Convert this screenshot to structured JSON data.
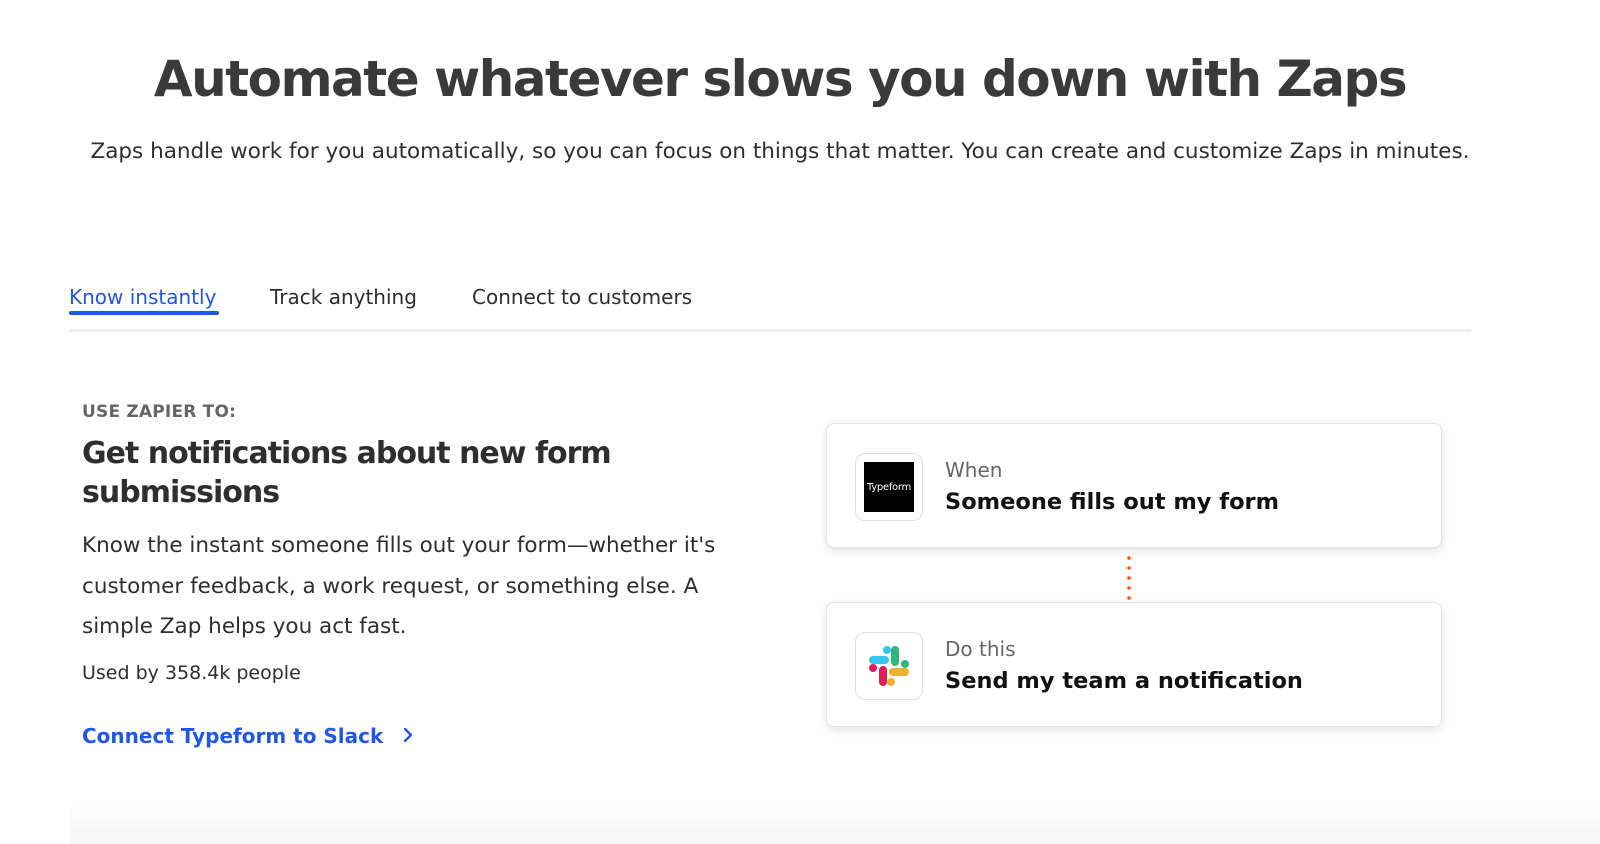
{
  "hero": {
    "title": "Automate whatever slows you down with Zaps",
    "subtitle": "Zaps handle work for you automatically, so you can focus on things that matter. You can create and customize Zaps in minutes."
  },
  "tabs": [
    {
      "label": "Know instantly",
      "active": true
    },
    {
      "label": "Track anything",
      "active": false
    },
    {
      "label": "Connect to customers",
      "active": false
    }
  ],
  "content": {
    "eyebrow": "USE ZAPIER TO:",
    "title": "Get notifications about new form submissions",
    "description": "Know the instant someone fills out your form—whether it's customer feedback, a work request, or something else. A simple Zap helps you act fast.",
    "usage": "Used by 358.4k people",
    "link_label": "Connect Typeform to Slack"
  },
  "zap": {
    "trigger": {
      "label": "When",
      "action": "Someone fills out my form",
      "app_name": "Typeform",
      "icon": "typeform-logo"
    },
    "action": {
      "label": "Do this",
      "action": "Send my team a notification",
      "icon": "slack-logo"
    }
  },
  "colors": {
    "accent": "#2156ea",
    "connector": "#ff4f00",
    "text": "#2d2e2e",
    "muted": "#666666"
  }
}
